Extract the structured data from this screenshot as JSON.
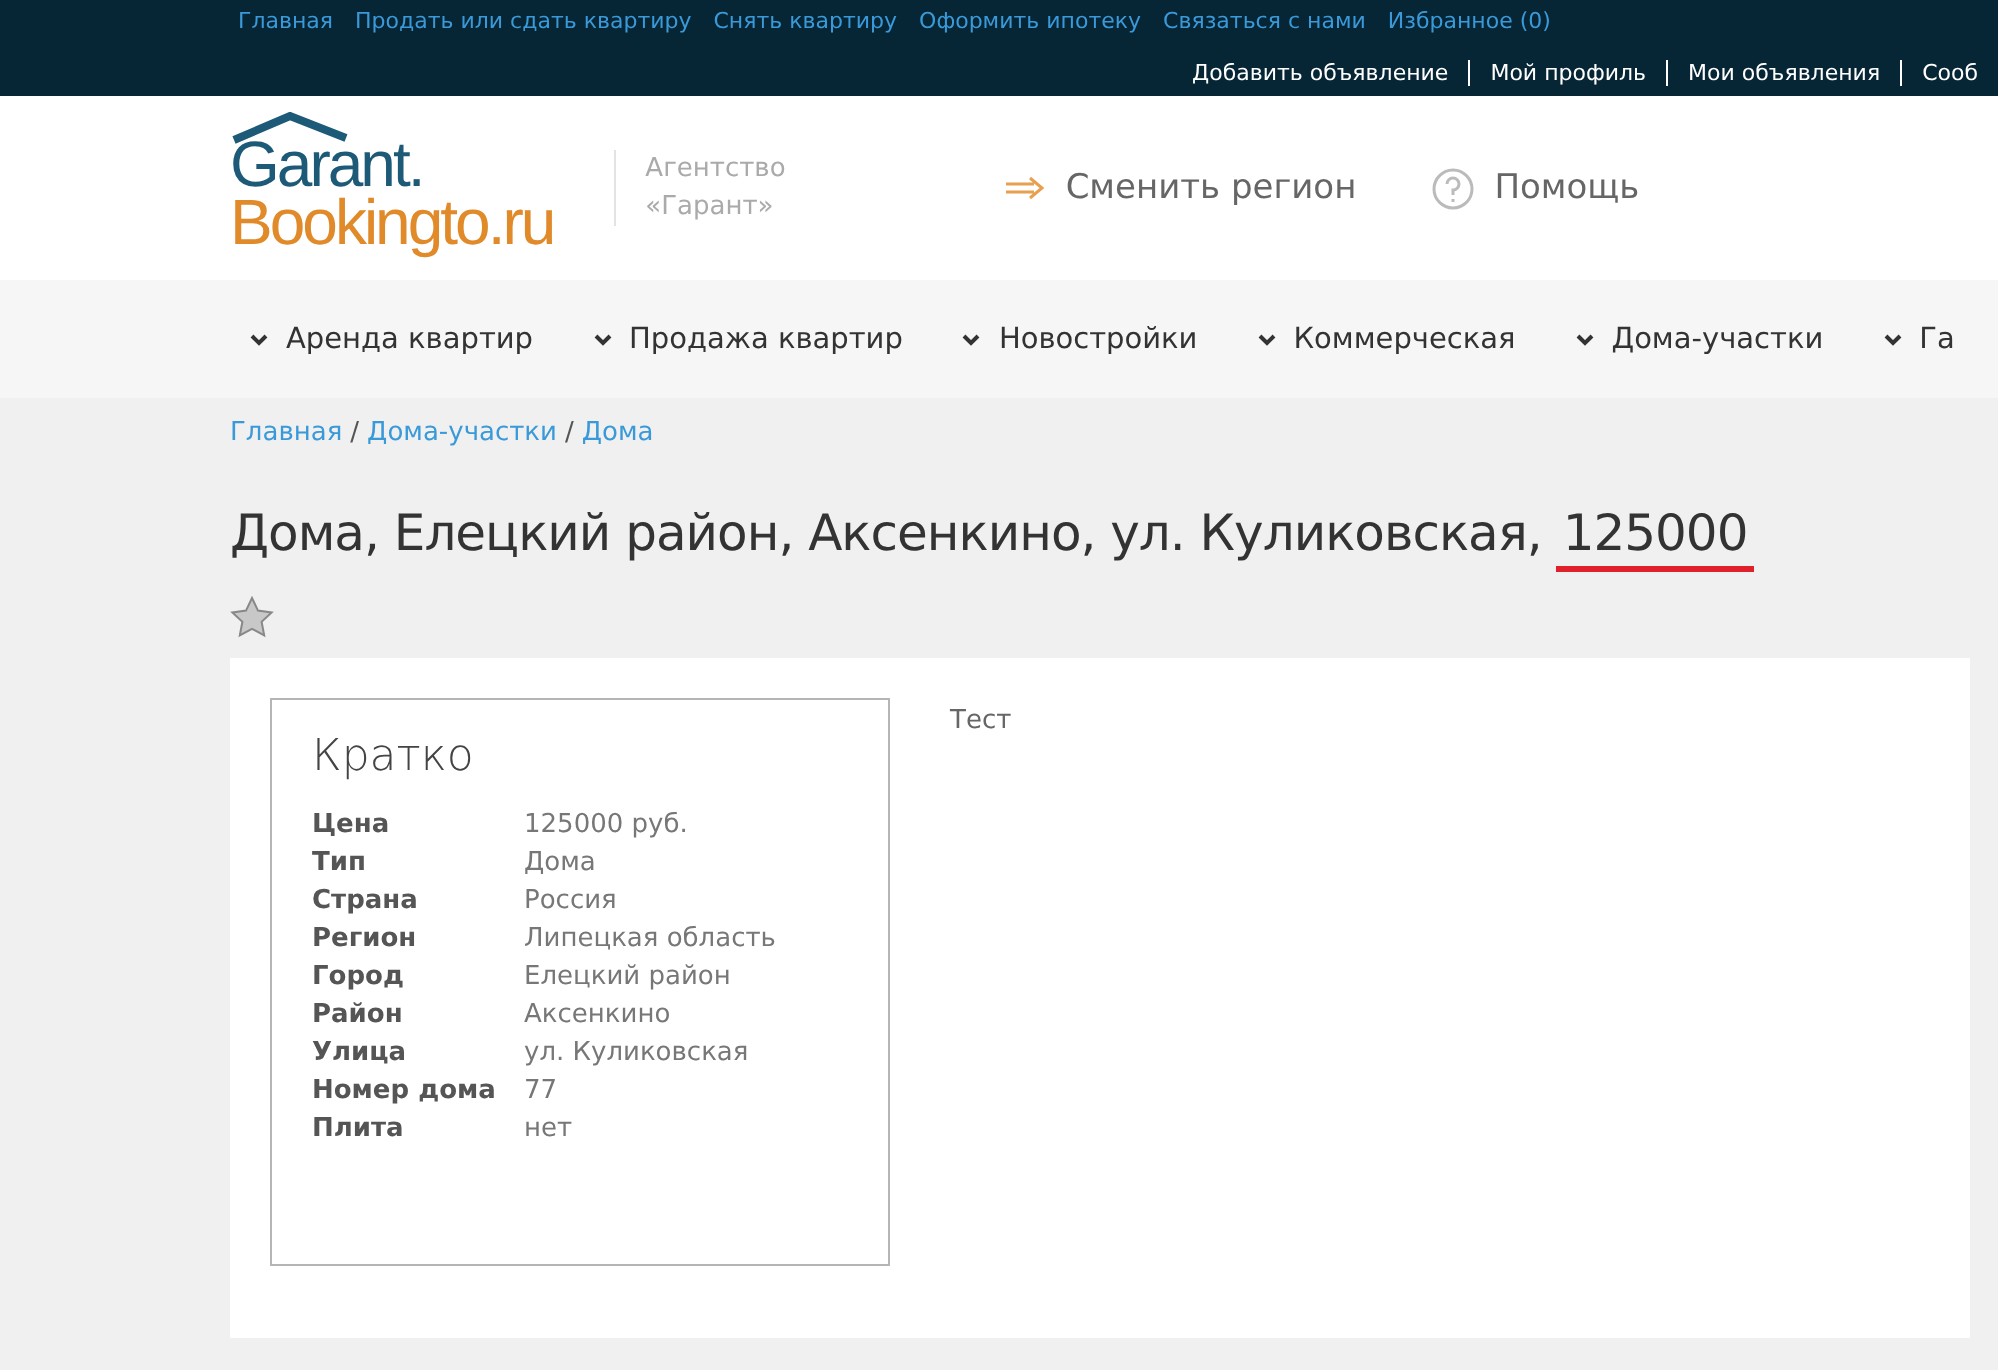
{
  "top_links": [
    "Главная",
    "Продать или сдать квартиру",
    "Снять квартиру",
    "Оформить ипотеку",
    "Связаться с нами",
    "Избранное (0)"
  ],
  "user_links": [
    "Добавить объявление",
    "Мой профиль",
    "Мои объявления",
    "Сооб"
  ],
  "logo": {
    "line1": "Garant.",
    "line2": "Bookingto.ru"
  },
  "agency": [
    "Агентство",
    "«Гарант»"
  ],
  "header_actions": [
    {
      "kind": "region",
      "label": "Сменить регион"
    },
    {
      "kind": "help",
      "label": "Помощь"
    }
  ],
  "nav": [
    "Аренда квартир",
    "Продажа квартир",
    "Новостройки",
    "Коммерческая",
    "Дома-участки",
    "Га"
  ],
  "breadcrumbs": [
    {
      "label": "Главная"
    },
    {
      "sep": "/",
      "label": "Дома-участки"
    },
    {
      "sep": "/",
      "label": "Дома"
    }
  ],
  "title": "Дома, Елецкий район, Аксенкино, ул. Куликовская,",
  "title_marked": "125000",
  "summary": {
    "heading": "Кратко",
    "rows": [
      {
        "label": "Цена",
        "value": "125000 руб."
      },
      {
        "label": "Тип",
        "value": "Дома"
      },
      {
        "label": "Страна",
        "value": "Россия"
      },
      {
        "label": "Регион",
        "value": "Липецкая область"
      },
      {
        "label": "Город",
        "value": "Елецкий район"
      },
      {
        "label": "Район",
        "value": "Аксенкино"
      },
      {
        "label": "Улица",
        "value": "ул. Куликовская"
      },
      {
        "label": "Номер дома",
        "value": "77"
      },
      {
        "label": "Плита",
        "value": "нет"
      }
    ]
  },
  "description": "Тест"
}
